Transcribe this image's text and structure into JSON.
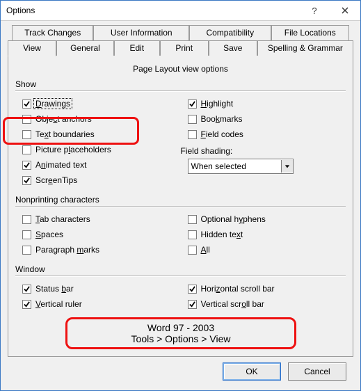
{
  "window": {
    "title": "Options"
  },
  "tabs": {
    "back": [
      {
        "label": "Track Changes"
      },
      {
        "label": "User Information"
      },
      {
        "label": "Compatibility"
      },
      {
        "label": "File Locations"
      }
    ],
    "front": [
      {
        "label": "View"
      },
      {
        "label": "General"
      },
      {
        "label": "Edit"
      },
      {
        "label": "Print"
      },
      {
        "label": "Save"
      },
      {
        "label": "Spelling & Grammar"
      }
    ],
    "active": "View"
  },
  "section_title": "Page Layout view options",
  "groups": {
    "show": {
      "label": "Show",
      "left": [
        {
          "id": "drawings",
          "pre": "",
          "u": "D",
          "post": "rawings",
          "checked": true,
          "focused": true
        },
        {
          "id": "object-anchors",
          "pre": "Obje",
          "u": "c",
          "post": "t anchors",
          "checked": false
        },
        {
          "id": "text-boundaries",
          "pre": "Te",
          "u": "x",
          "post": "t boundaries",
          "checked": false
        },
        {
          "id": "picture-placeholders",
          "pre": "Picture p",
          "u": "l",
          "post": "aceholders",
          "checked": false
        },
        {
          "id": "animated-text",
          "pre": "A",
          "u": "n",
          "post": "imated text",
          "checked": true
        },
        {
          "id": "screentips",
          "pre": "Scr",
          "u": "e",
          "post": "enTips",
          "checked": true
        }
      ],
      "right": [
        {
          "id": "highlight",
          "pre": "",
          "u": "H",
          "post": "ighlight",
          "checked": true
        },
        {
          "id": "bookmarks",
          "pre": "Boo",
          "u": "k",
          "post": "marks",
          "checked": false
        },
        {
          "id": "field-codes",
          "pre": "",
          "u": "F",
          "post": "ield codes",
          "checked": false
        }
      ],
      "field_shading": {
        "label": "Field shading:",
        "value": "When selected"
      }
    },
    "nonprinting": {
      "label": "Nonprinting characters",
      "left": [
        {
          "id": "tab-characters",
          "pre": "",
          "u": "T",
          "post": "ab characters",
          "checked": false
        },
        {
          "id": "spaces",
          "pre": "",
          "u": "S",
          "post": "paces",
          "checked": false
        },
        {
          "id": "paragraph-marks",
          "pre": "Paragraph ",
          "u": "m",
          "post": "arks",
          "checked": false
        }
      ],
      "right": [
        {
          "id": "optional-hyphens",
          "pre": "Optional h",
          "u": "y",
          "post": "phens",
          "checked": false
        },
        {
          "id": "hidden-text",
          "pre": "Hidden te",
          "u": "x",
          "post": "t",
          "checked": false
        },
        {
          "id": "all",
          "pre": "",
          "u": "A",
          "post": "ll",
          "checked": false
        }
      ]
    },
    "window": {
      "label": "Window",
      "left": [
        {
          "id": "status-bar",
          "pre": "Status ",
          "u": "b",
          "post": "ar",
          "checked": true
        },
        {
          "id": "vertical-ruler",
          "pre": "",
          "u": "V",
          "post": "ertical ruler",
          "checked": true
        }
      ],
      "right": [
        {
          "id": "horizontal-scroll",
          "pre": "Hori",
          "u": "z",
          "post": "ontal scroll bar",
          "checked": true
        },
        {
          "id": "vertical-scroll",
          "pre": "Vertical scr",
          "u": "o",
          "post": "ll bar",
          "checked": true
        }
      ]
    }
  },
  "annotation": {
    "line1": "Word 97 - 2003",
    "line2": "Tools > Options > View"
  },
  "buttons": {
    "ok": "OK",
    "cancel": "Cancel"
  },
  "colors": {
    "accent": "#e11",
    "border": "#9a9a9a",
    "title_border": "#3a78c4"
  }
}
